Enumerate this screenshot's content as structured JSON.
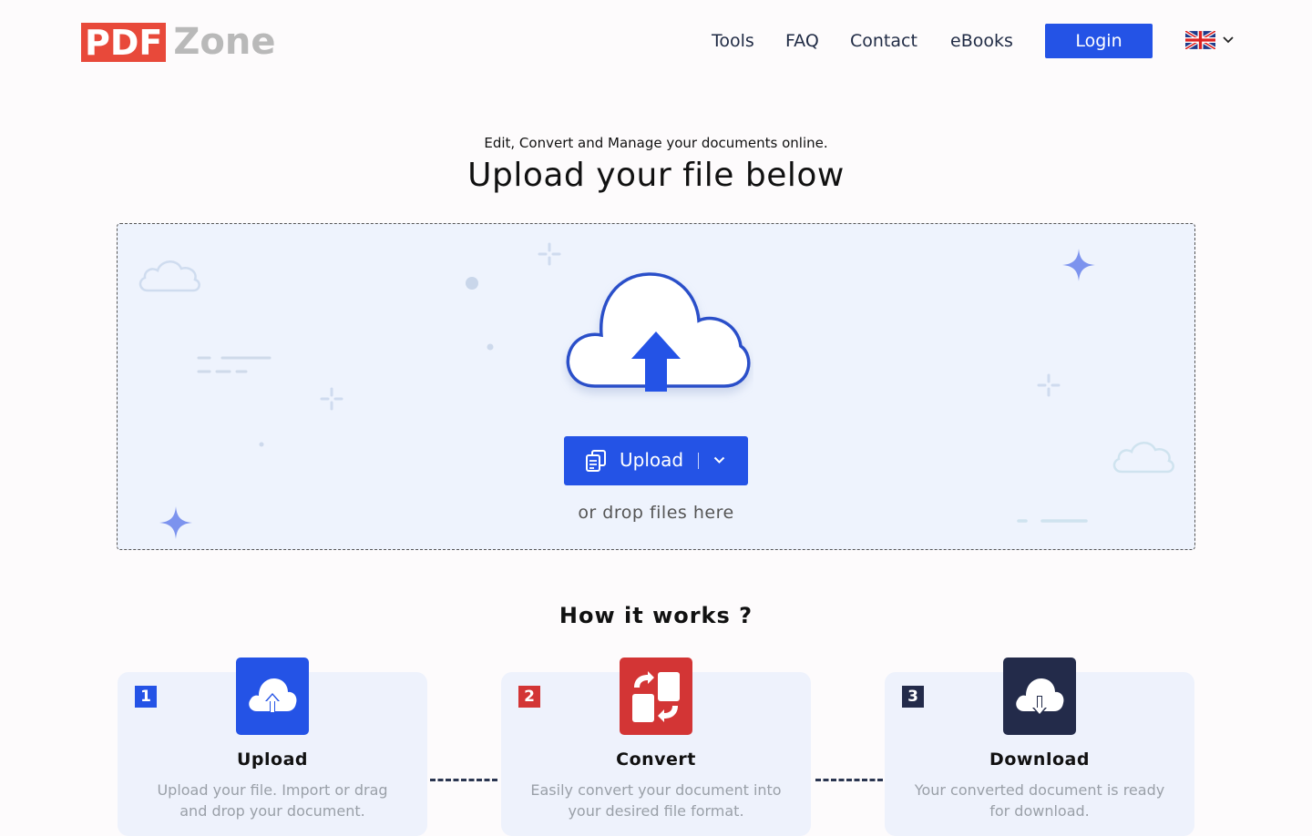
{
  "brand": {
    "logo_left": "PDF",
    "logo_right": "Zone"
  },
  "nav": {
    "links": [
      "Tools",
      "FAQ",
      "Contact",
      "eBooks"
    ],
    "login_label": "Login",
    "language_icon": "uk-flag-icon"
  },
  "hero": {
    "subtitle": "Edit, Convert and Manage your documents online.",
    "title": "Upload your file below"
  },
  "dropzone": {
    "upload_label": "Upload",
    "drop_hint": "or drop files here"
  },
  "how": {
    "title": "How it works ?",
    "steps": [
      {
        "number": "1",
        "name": "Upload",
        "desc": "Upload your file. Import or drag and drop your document.",
        "color": "#2453e6",
        "icon": "cloud-upload-icon"
      },
      {
        "number": "2",
        "name": "Convert",
        "desc": "Easily convert your document into your desired file format.",
        "color": "#d33535",
        "icon": "convert-icon"
      },
      {
        "number": "3",
        "name": "Download",
        "desc": "Your converted document is ready for download.",
        "color": "#232b4a",
        "icon": "cloud-download-icon"
      }
    ]
  },
  "colors": {
    "primary": "#2453e6",
    "logo_red": "#e8493a",
    "dropzone_bg": "#eef3fd"
  }
}
